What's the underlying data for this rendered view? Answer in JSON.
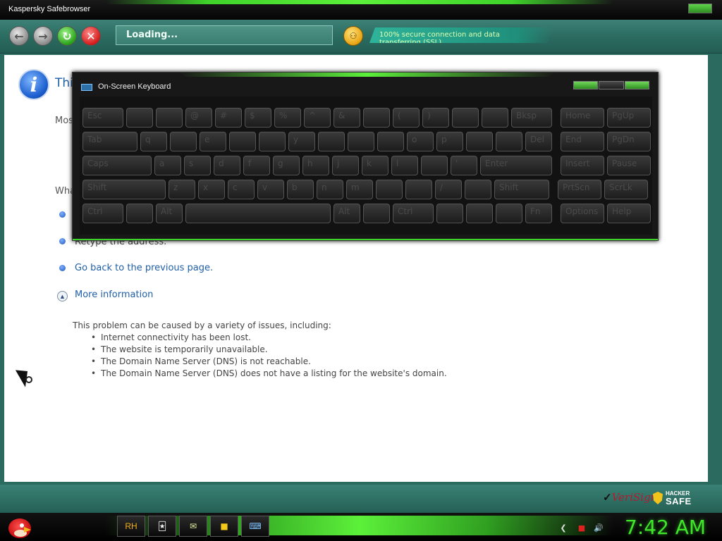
{
  "window": {
    "title": "Kaspersky Safebrowser"
  },
  "toolbar": {
    "address_text": "Loading...",
    "ssl_text": "100% secure connection and data transferring (SSL)"
  },
  "page": {
    "title_fragment": "Thi",
    "subtitle_fragment": "Mos",
    "what_fragment": "Wha",
    "links": [
      "Retype the address.",
      "Go back to the previous page."
    ],
    "more_info": "More information",
    "details_intro": "This problem can be caused by a variety of issues, including:",
    "details_items": [
      "Internet connectivity has been lost.",
      "The website is temporarily unavailable.",
      "The Domain Name Server (DNS) is not reachable.",
      "The Domain Name Server (DNS) does not have a listing for the website's domain."
    ]
  },
  "keyboard": {
    "title": "On-Screen Keyboard",
    "rows": [
      [
        "Esc",
        "",
        "",
        "@",
        "#",
        "$",
        "%",
        "^",
        "&",
        "",
        "(",
        ")",
        "",
        "",
        "Bksp",
        "Home",
        "PgUp"
      ],
      [
        "Tab",
        "q",
        "",
        "e",
        "",
        "",
        "y",
        "",
        "",
        "",
        "o",
        "p",
        "",
        "",
        "Del",
        "End",
        "PgDn"
      ],
      [
        "Caps",
        "a",
        "s",
        "d",
        "f",
        "g",
        "h",
        "j",
        "k",
        "l",
        "",
        "'",
        "Enter",
        "Insert",
        "Pause"
      ],
      [
        "Shift",
        "z",
        "x",
        "c",
        "v",
        "b",
        "n",
        "m",
        "",
        "",
        "/",
        "",
        "Shift",
        "PrtScn",
        "ScrLk"
      ],
      [
        "Ctrl",
        "",
        "Alt",
        "",
        "Alt",
        "",
        "Ctrl",
        "",
        "",
        "",
        "Fn",
        "Options",
        "Help"
      ]
    ]
  },
  "status": {
    "verisign": "VeriSign",
    "hacker": "HACKER",
    "safe": "SAFE"
  },
  "taskbar": {
    "items": [
      "RH"
    ],
    "clock": "7:42 AM"
  }
}
